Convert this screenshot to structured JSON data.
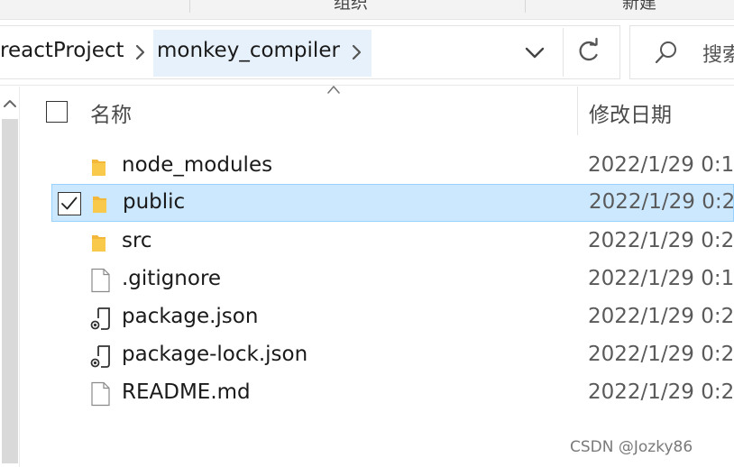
{
  "ribbon": {
    "groups": [
      "组织",
      "新建"
    ]
  },
  "address_bar": {
    "breadcrumbs": [
      "reactProject",
      "monkey_compiler"
    ],
    "icons": {
      "separator": "chevron-right-icon",
      "dropdown": "chevron-down-icon",
      "refresh": "refresh-icon"
    }
  },
  "search": {
    "placeholder": "搜索",
    "icon": "search-icon"
  },
  "columns": {
    "name": "名称",
    "date_modified": "修改日期",
    "sort": "ascending"
  },
  "files": [
    {
      "name": "node_modules",
      "type": "folder",
      "date": "2022/1/29 0:1",
      "selected": false
    },
    {
      "name": "public",
      "type": "folder",
      "date": "2022/1/29 0:2",
      "selected": true
    },
    {
      "name": "src",
      "type": "folder",
      "date": "2022/1/29 0:2",
      "selected": false
    },
    {
      "name": ".gitignore",
      "type": "file",
      "date": "2022/1/29 0:1",
      "selected": false
    },
    {
      "name": "package.json",
      "type": "json",
      "date": "2022/1/29 0:2",
      "selected": false
    },
    {
      "name": "package-lock.json",
      "type": "json",
      "date": "2022/1/29 0:2",
      "selected": false
    },
    {
      "name": "README.md",
      "type": "file",
      "date": "2022/1/29 0:2",
      "selected": false
    }
  ],
  "colors": {
    "selection_background": "#cce8ff",
    "selection_border": "#99d1ff",
    "folder_yellow": "#f8c94a",
    "breadcrumb_hover": "#e7f1fb"
  },
  "watermark": "CSDN @Jozky86"
}
